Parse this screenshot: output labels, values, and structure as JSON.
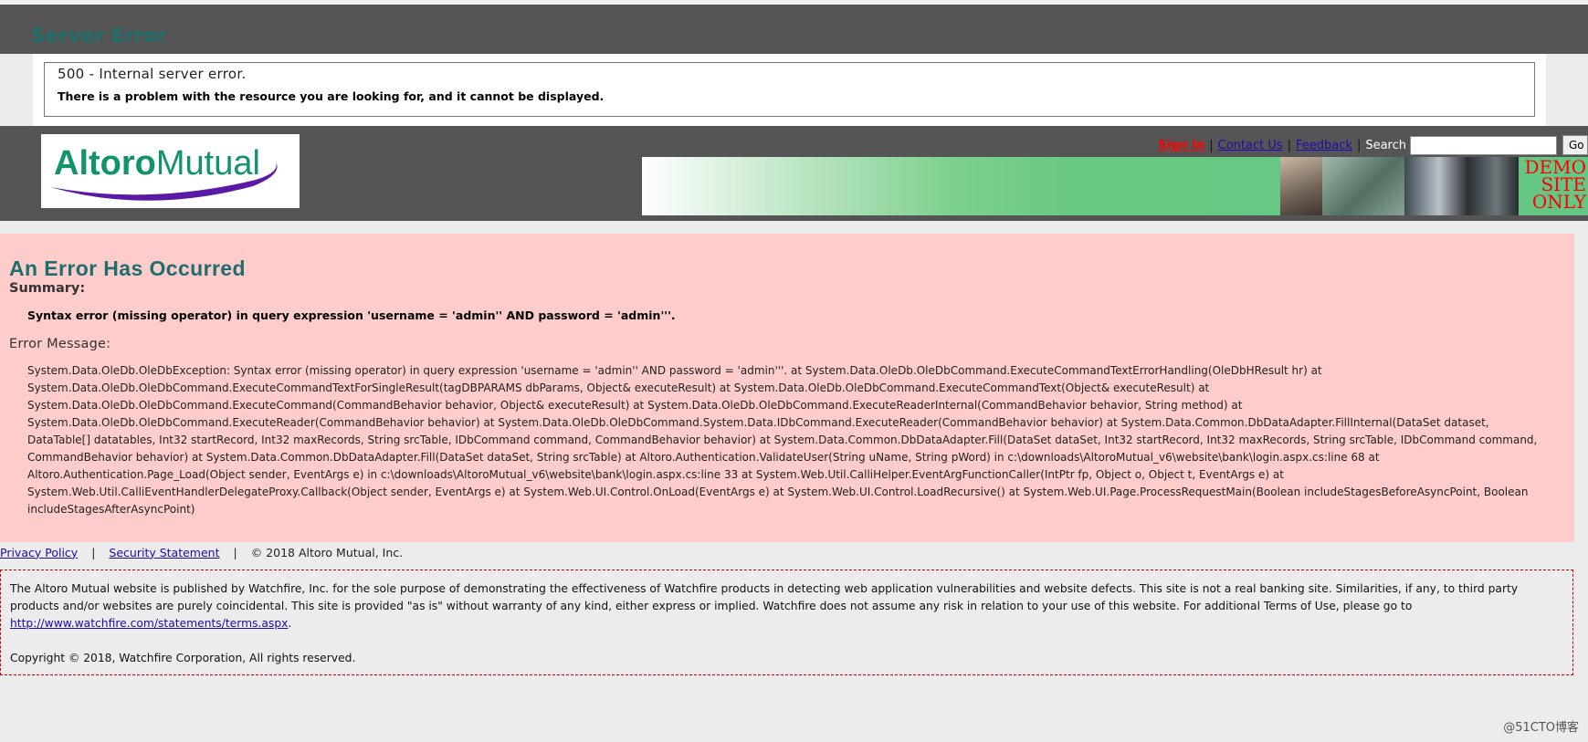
{
  "iis": {
    "title": "Server Error",
    "code_line": "500 - Internal server error.",
    "description": "There is a problem with the resource you are looking for, and it cannot be displayed."
  },
  "header": {
    "logo_text": "AltoroMutual",
    "sign_in": "Sign In",
    "contact_us": "Contact Us",
    "feedback": "Feedback",
    "separator": "|",
    "search_label": "Search",
    "search_value": "",
    "go_label": "Go",
    "demo_line1": "DEMO",
    "demo_line2": "SITE",
    "demo_line3": "ONLY"
  },
  "error": {
    "title": "An Error Has Occurred",
    "summary_label": "Summary:",
    "summary_text": "Syntax error (missing operator) in query expression 'username = 'admin'' AND password = 'admin'''.",
    "message_label": "Error Message:",
    "message_text": "System.Data.OleDb.OleDbException: Syntax error (missing operator) in query expression 'username = 'admin'' AND password = 'admin'''. at System.Data.OleDb.OleDbCommand.ExecuteCommandTextErrorHandling(OleDbHResult hr) at System.Data.OleDb.OleDbCommand.ExecuteCommandTextForSingleResult(tagDBPARAMS dbParams, Object& executeResult) at System.Data.OleDb.OleDbCommand.ExecuteCommandText(Object& executeResult) at System.Data.OleDb.OleDbCommand.ExecuteCommand(CommandBehavior behavior, Object& executeResult) at System.Data.OleDb.OleDbCommand.ExecuteReaderInternal(CommandBehavior behavior, String method) at System.Data.OleDb.OleDbCommand.ExecuteReader(CommandBehavior behavior) at System.Data.OleDb.OleDbCommand.System.Data.IDbCommand.ExecuteReader(CommandBehavior behavior) at System.Data.Common.DbDataAdapter.FillInternal(DataSet dataset, DataTable[] datatables, Int32 startRecord, Int32 maxRecords, String srcTable, IDbCommand command, CommandBehavior behavior) at System.Data.Common.DbDataAdapter.Fill(DataSet dataSet, Int32 startRecord, Int32 maxRecords, String srcTable, IDbCommand command, CommandBehavior behavior) at System.Data.Common.DbDataAdapter.Fill(DataSet dataSet, String srcTable) at Altoro.Authentication.ValidateUser(String uName, String pWord) in c:\\downloads\\AltoroMutual_v6\\website\\bank\\login.aspx.cs:line 68 at Altoro.Authentication.Page_Load(Object sender, EventArgs e) in c:\\downloads\\AltoroMutual_v6\\website\\bank\\login.aspx.cs:line 33 at System.Web.Util.CalliHelper.EventArgFunctionCaller(IntPtr fp, Object o, Object t, EventArgs e) at System.Web.Util.CalliEventHandlerDelegateProxy.Callback(Object sender, EventArgs e) at System.Web.UI.Control.OnLoad(EventArgs e) at System.Web.UI.Control.LoadRecursive() at System.Web.UI.Page.ProcessRequestMain(Boolean includeStagesBeforeAsyncPoint, Boolean includeStagesAfterAsyncPoint)"
  },
  "footer": {
    "privacy_policy": "Privacy Policy",
    "security_statement": "Security Statement",
    "separator": "|",
    "copyright": "© 2018 Altoro Mutual, Inc.",
    "disclaimer_text": "The Altoro Mutual website is published by Watchfire, Inc. for the sole purpose of demonstrating the effectiveness of Watchfire products in detecting web application vulnerabilities and website defects. This site is not a real banking site. Similarities, if any, to third party products and/or websites are purely coincidental. This site is provided \"as is\" without warranty of any kind, either express or implied. Watchfire does not assume any risk in relation to your use of this website. For additional Terms of Use, please go to",
    "terms_link": "http://www.watchfire.com/statements/terms.aspx",
    "terms_period": ".",
    "watchfire_copyright": "Copyright © 2018, Watchfire Corporation, All rights reserved."
  },
  "watermark": "@51CTO博客",
  "colors": {
    "header_bg": "#555555",
    "error_bg": "#ffcccc",
    "title_teal": "#1f6e6e",
    "sign_in_red": "#ff0000",
    "link_blue": "#1a0dab",
    "banner_green": "#66c684"
  }
}
